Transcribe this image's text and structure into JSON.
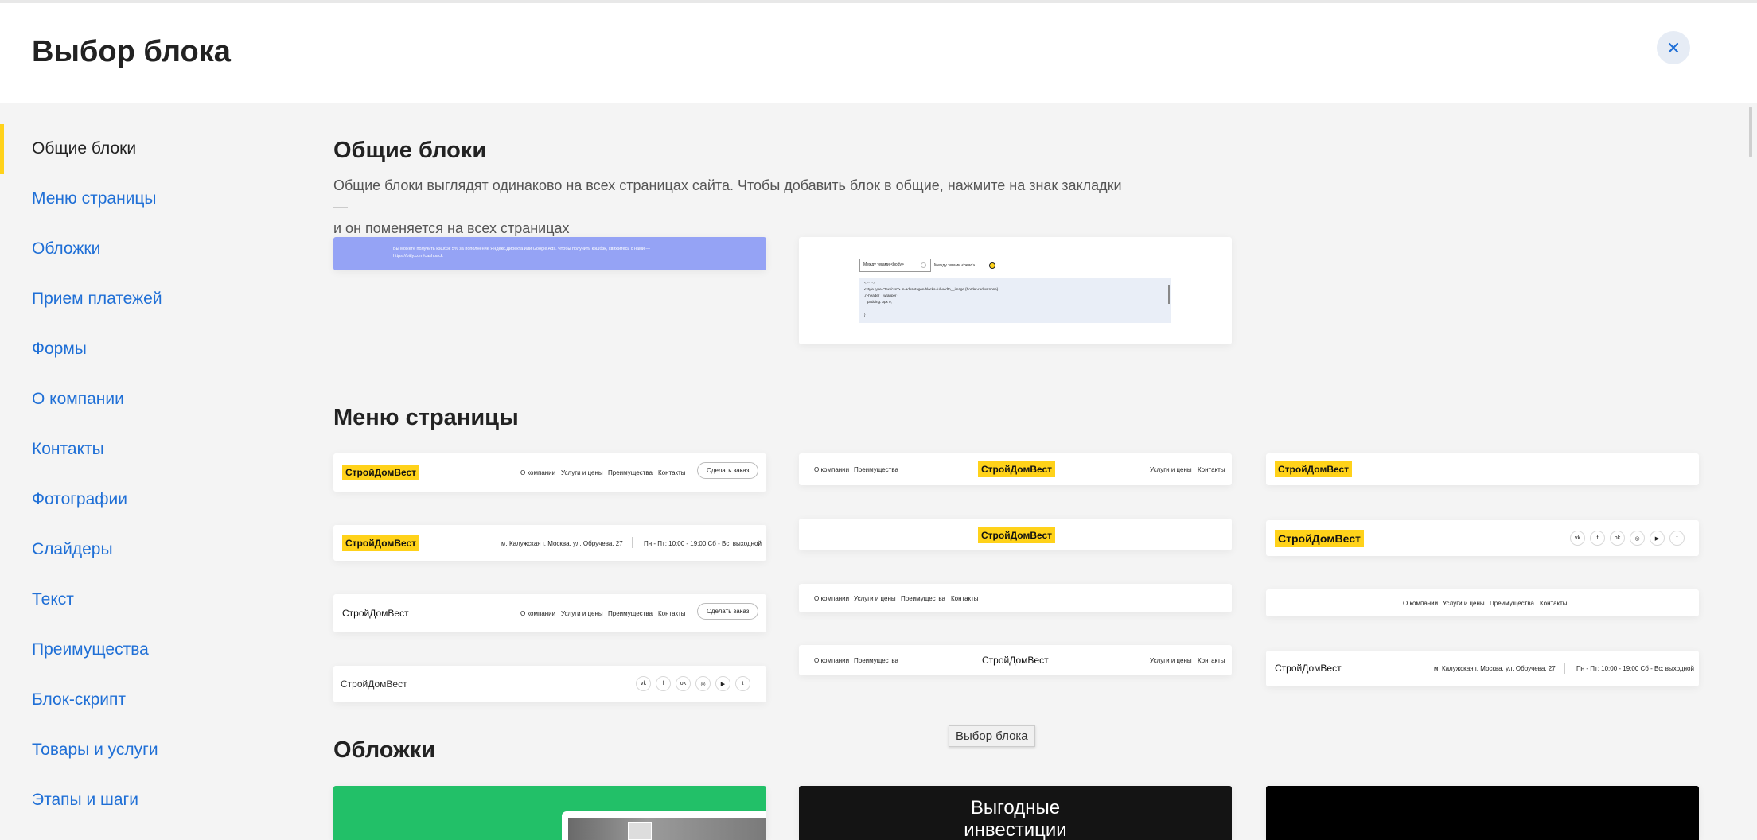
{
  "header": {
    "title": "Выбор блока",
    "close_icon": "close-icon"
  },
  "colors": {
    "accent_yellow": "#ffd21a",
    "link_blue": "#1f6fd6",
    "cover_green": "#22c068",
    "cookie_banner": "#95a3f5"
  },
  "sidebar": {
    "items": [
      {
        "label": "Общие блоки",
        "active": true
      },
      {
        "label": "Меню страницы"
      },
      {
        "label": "Обложки"
      },
      {
        "label": "Прием платежей"
      },
      {
        "label": "Формы"
      },
      {
        "label": "О компании"
      },
      {
        "label": "Контакты"
      },
      {
        "label": "Фотографии"
      },
      {
        "label": "Слайдеры"
      },
      {
        "label": "Текст"
      },
      {
        "label": "Преимущества"
      },
      {
        "label": "Блок-скрипт"
      },
      {
        "label": "Товары и услуги"
      },
      {
        "label": "Этапы и шаги"
      }
    ]
  },
  "sections": {
    "common": {
      "title": "Общие блоки",
      "description_line1": "Общие блоки выглядят одинаково на всех страницах сайта. Чтобы добавить блок в общие, нажмите на знак закладки —",
      "description_line2": "и он поменяется на всех страницах",
      "cookie_text_line1": "Вы можете получить кэшбэк 5% за пополнение Яндекс.Директа или Google Ads. Чтобы получить кэшбэк, свяжитесь с нами —",
      "cookie_text_line2": "https://bitly.com/cashback",
      "code_select1": "Между тегами <body>",
      "code_select2": "Между тегами <head>",
      "code_line1": "<!-- -->",
      "code_line2": "<style type=\"text/css\"> .n-advantages-blocks-full-width__image {border-radius:none}",
      "code_line3": ".n-header__wrapper {",
      "code_line4": "padding: 0px 0;",
      "code_line5": "}"
    },
    "menu": {
      "title": "Меню страницы"
    },
    "covers": {
      "title": "Обложки",
      "cover2_line1": "Выгодные",
      "cover2_line2": "инвестиции"
    }
  },
  "menu_preview": {
    "brand": "СтройДомВест",
    "nav": [
      "О компании",
      "Услуги и цены",
      "Преимущества",
      "Контакты"
    ],
    "nav_short": [
      "О компании",
      "Преимущества"
    ],
    "nav_right": [
      "Услуги и цены",
      "Контакты"
    ],
    "cta": "Сделать заказ",
    "address": "м. Калужская г. Москва, ул. Обручева, 27",
    "hours": "Пн - Пт: 10:00 - 19:00 Сб - Вс: выходной",
    "socials": [
      "vk",
      "f",
      "ok",
      "ig",
      "yt",
      "tw"
    ]
  },
  "tooltip": "Выбор блока"
}
